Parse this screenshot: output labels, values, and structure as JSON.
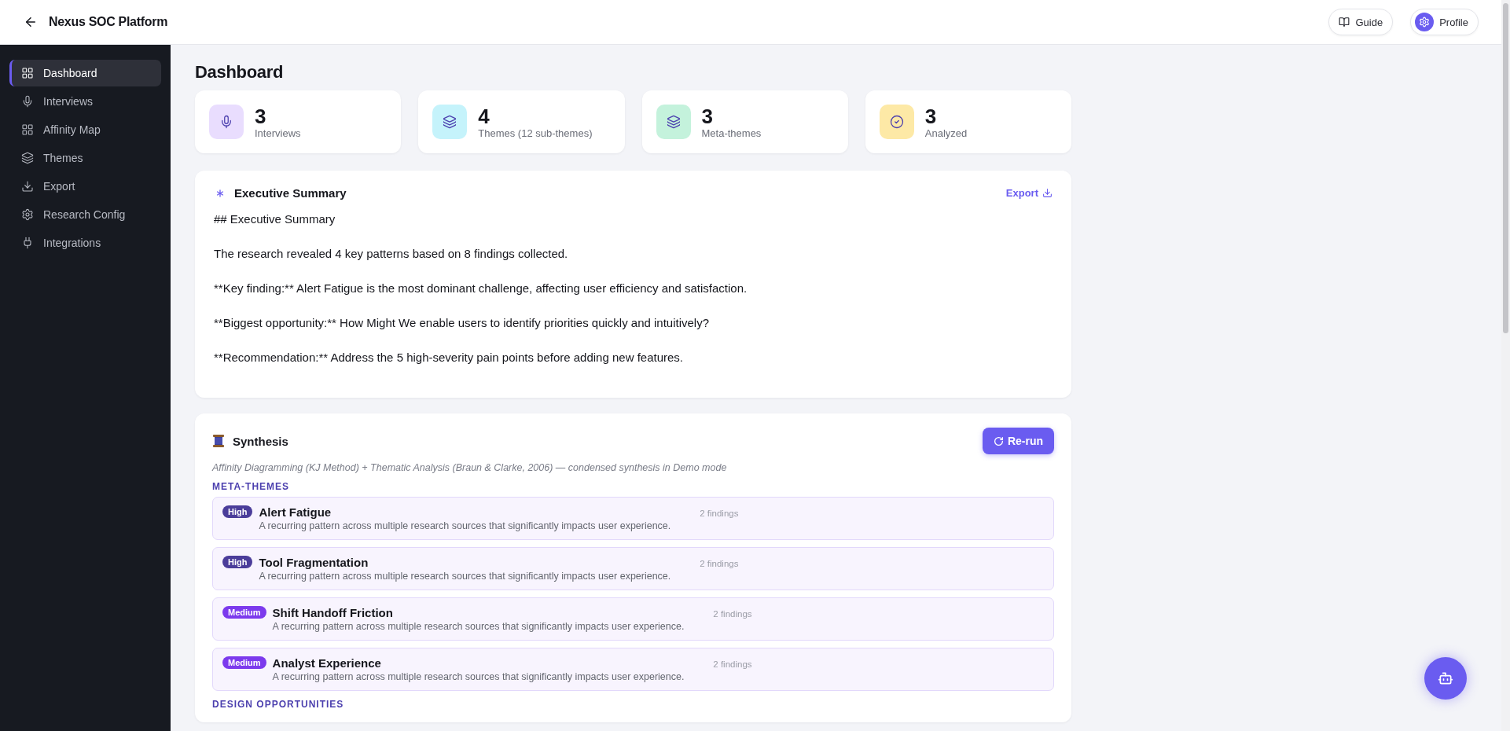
{
  "topbar": {
    "title": "Nexus SOC Platform",
    "actions": [
      {
        "kind": "guide",
        "label": "Guide"
      },
      {
        "kind": "profile",
        "label": "Profile"
      }
    ]
  },
  "sidebar": {
    "items": [
      {
        "label": "Dashboard",
        "selected": true
      },
      {
        "label": "Interviews",
        "selected": false
      },
      {
        "label": "Affinity Map",
        "selected": false
      },
      {
        "label": "Themes",
        "selected": false
      },
      {
        "label": "Export",
        "selected": false
      },
      {
        "label": "Research Config",
        "selected": false
      },
      {
        "label": "Integrations",
        "selected": false
      }
    ]
  },
  "page_title": "Dashboard",
  "stats": [
    {
      "value": "3",
      "label": "Interviews",
      "color": "#e9ddfe"
    },
    {
      "value": "4",
      "label": "Themes (12 sub-themes)",
      "color": "#c5f3fb"
    },
    {
      "value": "3",
      "label": "Meta-themes",
      "color": "#c4f2dc"
    },
    {
      "value": "3",
      "label": "Analyzed",
      "color": "#fde9a6"
    }
  ],
  "summary": {
    "title": "Executive Summary",
    "action": "Export",
    "paragraphs": [
      "## Executive Summary",
      "The research revealed 4 key patterns based on 8 findings collected.",
      "**Key finding:** Alert Fatigue is the most dominant challenge, affecting user efficiency and satisfaction.",
      "**Biggest opportunity:** How Might We enable users to identify priorities quickly and intuitively?",
      "**Recommendation:** Address the 5 high-severity pain points before adding new features."
    ]
  },
  "synthesis": {
    "title": "Synthesis",
    "button": "Re-run",
    "subtitle": "Affinity Diagramming (KJ Method) + Thematic Analysis (Braun & Clarke, 2006) — condensed synthesis in Demo mode",
    "section_label": "META-THEMES",
    "meta_themes": [
      {
        "kind": "high",
        "badge": "High",
        "title": "Alert Fatigue",
        "findings": "2 findings",
        "description": "A recurring pattern across multiple research sources that significantly impacts user experience."
      },
      {
        "kind": "high",
        "badge": "High",
        "title": "Tool Fragmentation",
        "findings": "2 findings",
        "description": "A recurring pattern across multiple research sources that significantly impacts user experience."
      },
      {
        "kind": "medium",
        "badge": "Medium",
        "title": "Shift Handoff Friction",
        "findings": "2 findings",
        "description": "A recurring pattern across multiple research sources that significantly impacts user experience."
      },
      {
        "kind": "medium",
        "badge": "Medium",
        "title": "Analyst Experience",
        "findings": "2 findings",
        "description": "A recurring pattern across multiple research sources that significantly impacts user experience."
      }
    ],
    "next_section_label": "DESIGN OPPORTUNITIES"
  }
}
